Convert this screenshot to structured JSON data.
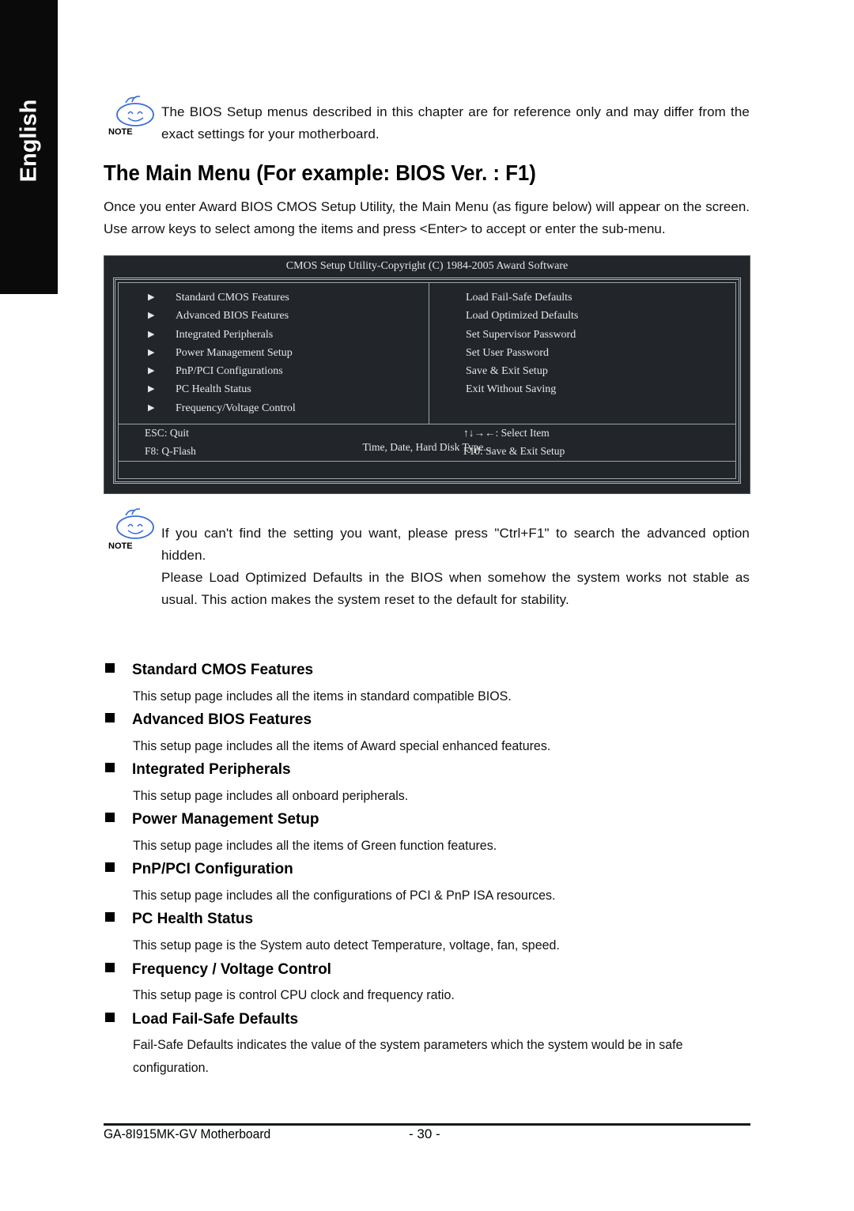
{
  "side_tab": {
    "label": "English"
  },
  "notes": [
    {
      "icon": "note-smiley-icon",
      "badge": "NOTE",
      "text": "The BIOS Setup menus described in this chapter are for reference only and may differ from the exact settings for your motherboard."
    },
    {
      "icon": "note-smiley-icon",
      "badge": "NOTE",
      "text": "If you can't find the setting you want, please press \"Ctrl+F1\" to search the advanced option hidden.",
      "text2": "Please Load Optimized Defaults in the BIOS when somehow the system works not stable as usual. This action makes the system reset to the default for stability."
    }
  ],
  "heading": "The Main Menu (For example: BIOS Ver. : F1)",
  "intro": "Once you enter Award BIOS CMOS Setup Utility, the Main Menu (as figure below) will appear on the screen. Use arrow keys to select among the items and press <Enter> to accept or enter the sub-menu.",
  "bios_screen": {
    "title": "CMOS Setup Utility-Copyright (C) 1984-2005 Award Software",
    "left_menu": [
      "Standard CMOS Features",
      "Advanced BIOS Features",
      "Integrated Peripherals",
      "Power Management Setup",
      "PnP/PCI Configurations",
      "PC Health Status",
      "Frequency/Voltage Control"
    ],
    "right_menu": [
      "Load Fail-Safe Defaults",
      "Load Optimized Defaults",
      "Set Supervisor Password",
      "Set User Password",
      "Save & Exit Setup",
      "Exit Without Saving"
    ],
    "keys": {
      "esc": "ESC: Quit",
      "f8": "F8: Q-Flash",
      "select": "↑↓→←: Select Item",
      "f10": "F10: Save & Exit Setup"
    },
    "hint": "Time, Date, Hard Disk Type..."
  },
  "sections": [
    {
      "title": "Standard CMOS Features",
      "body": "This setup page includes all the items in standard compatible BIOS."
    },
    {
      "title": "Advanced BIOS Features",
      "body": "This setup page includes all the items of Award special enhanced features."
    },
    {
      "title": "Integrated Peripherals",
      "body": "This setup page includes all onboard peripherals."
    },
    {
      "title": "Power Management Setup",
      "body": "This setup page includes all the items of Green function features."
    },
    {
      "title": "PnP/PCI Configuration",
      "body": "This setup page includes all the configurations of PCI & PnP ISA resources."
    },
    {
      "title": "PC Health Status",
      "body": "This setup page is the System auto detect Temperature, voltage, fan, speed."
    },
    {
      "title": "Frequency / Voltage Control",
      "body": "This setup page is control CPU clock and frequency ratio."
    },
    {
      "title": "Load Fail-Safe Defaults",
      "body": "Fail-Safe Defaults indicates the value of the system parameters which the system would be in safe configuration."
    }
  ],
  "footer": {
    "model": "GA-8I915MK-GV Motherboard",
    "page": "- 30 -"
  }
}
